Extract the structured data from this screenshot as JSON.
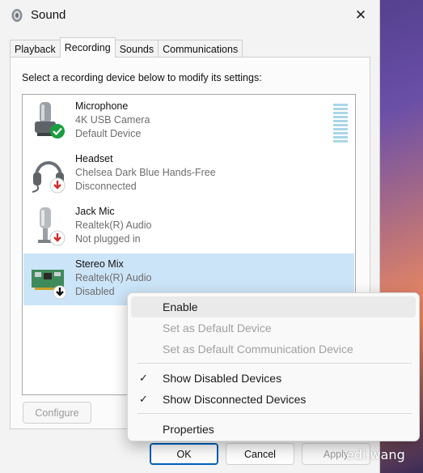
{
  "window": {
    "title": "Sound"
  },
  "tabs": [
    {
      "label": "Playback"
    },
    {
      "label": "Recording"
    },
    {
      "label": "Sounds"
    },
    {
      "label": "Communications"
    }
  ],
  "active_tab": "Recording",
  "instruction": "Select a recording device below to modify its settings:",
  "devices": [
    {
      "name": "Microphone",
      "device": "4K USB Camera",
      "status": "Default Device",
      "badge": "check-icon",
      "icon": "microphone-icon"
    },
    {
      "name": "Headset",
      "device": "Chelsea Dark Blue Hands-Free",
      "status": "Disconnected",
      "badge": "red-down-arrow-icon",
      "icon": "headset-icon"
    },
    {
      "name": "Jack Mic",
      "device": "Realtek(R) Audio",
      "status": "Not plugged in",
      "badge": "red-down-arrow-icon",
      "icon": "microphone-icon"
    },
    {
      "name": "Stereo Mix",
      "device": "Realtek(R) Audio",
      "status": "Disabled",
      "badge": "black-down-arrow-icon",
      "icon": "sound-card-icon",
      "selected": true
    }
  ],
  "buttons": {
    "configure": "Configure",
    "ok": "OK",
    "cancel": "Cancel",
    "apply": "Apply"
  },
  "context_menu": {
    "items": [
      {
        "label": "Enable",
        "enabled": true,
        "highlighted": true
      },
      {
        "label": "Set as Default Device",
        "enabled": false
      },
      {
        "label": "Set as Default Communication Device",
        "enabled": false
      },
      {
        "label": "Show Disabled Devices",
        "checked": true
      },
      {
        "label": "Show Disconnected Devices",
        "checked": true
      },
      {
        "label": "Properties",
        "enabled": true
      }
    ]
  },
  "watermark": "edi.wang",
  "colors": {
    "selection": "#cce4f7",
    "accent": "#005fb8",
    "check_badge": "#1a9e3f",
    "arrow_badge": "#d32f2f"
  }
}
